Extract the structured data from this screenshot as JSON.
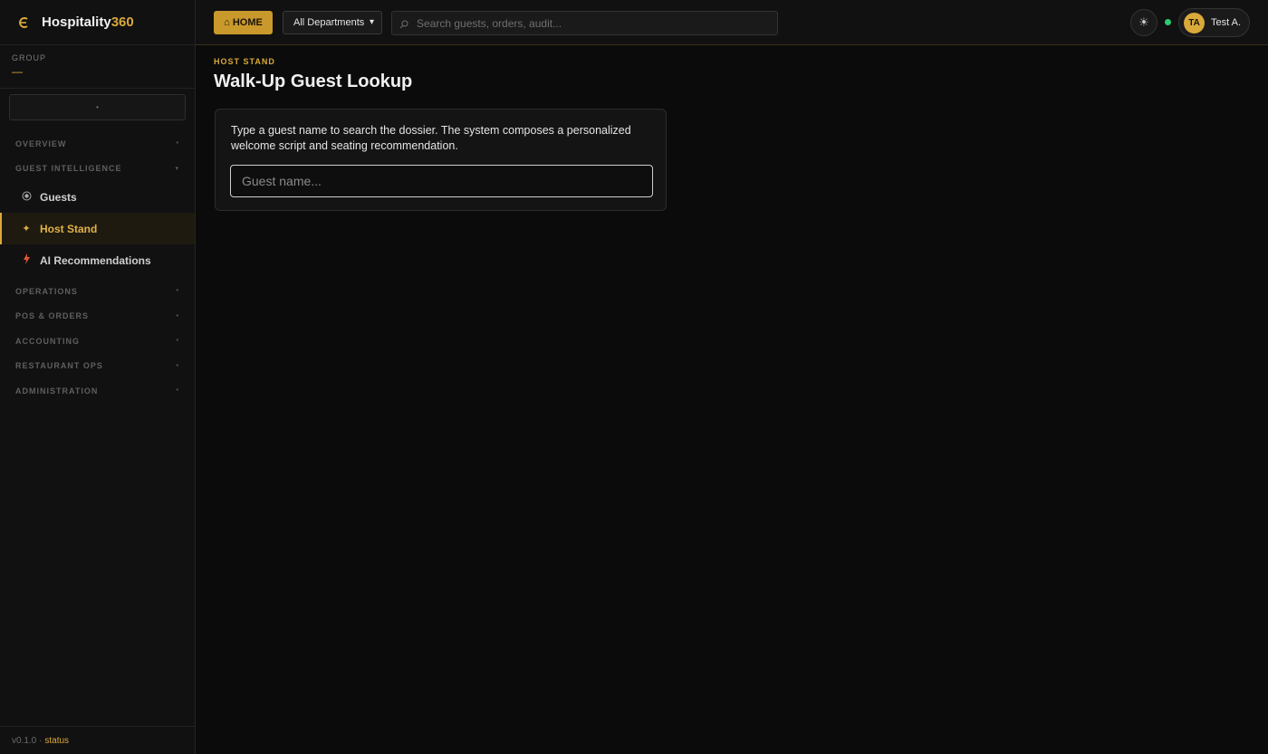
{
  "brand": {
    "name": "Hospitality",
    "accent": "360"
  },
  "group": {
    "label": "GROUP",
    "value": "—"
  },
  "sidebar": {
    "sections": [
      {
        "label": "OVERVIEW"
      },
      {
        "label": "GUEST INTELLIGENCE"
      },
      {
        "label": "OPERATIONS"
      },
      {
        "label": "POS & ORDERS"
      },
      {
        "label": "ACCOUNTING"
      },
      {
        "label": "RESTAURANT OPS"
      },
      {
        "label": "ADMINISTRATION"
      }
    ],
    "items": [
      {
        "label": "Guests",
        "icon": "eye-icon"
      },
      {
        "label": "Host Stand",
        "icon": "sparkle-icon",
        "active": true
      },
      {
        "label": "AI Recommendations",
        "icon": "bolt-icon"
      }
    ],
    "footer": {
      "version": "v0.1.0 ·",
      "status": "status"
    }
  },
  "topbar": {
    "home_label": "⌂ HOME",
    "department": "All Departments",
    "search_placeholder": "Search guests, orders, audit...",
    "theme_icon": "☀",
    "user": {
      "initials": "TA",
      "name": "Test A."
    }
  },
  "page": {
    "eyebrow": "HOST STAND",
    "title": "Walk-Up Guest Lookup",
    "description": "Type a guest name to search the dossier. The system composes a personalized welcome script and seating recommendation.",
    "guest_placeholder": "Guest name..."
  },
  "colors": {
    "accent": "#d9a93a",
    "online": "#2ecc71",
    "background": "#0b0b0b"
  }
}
